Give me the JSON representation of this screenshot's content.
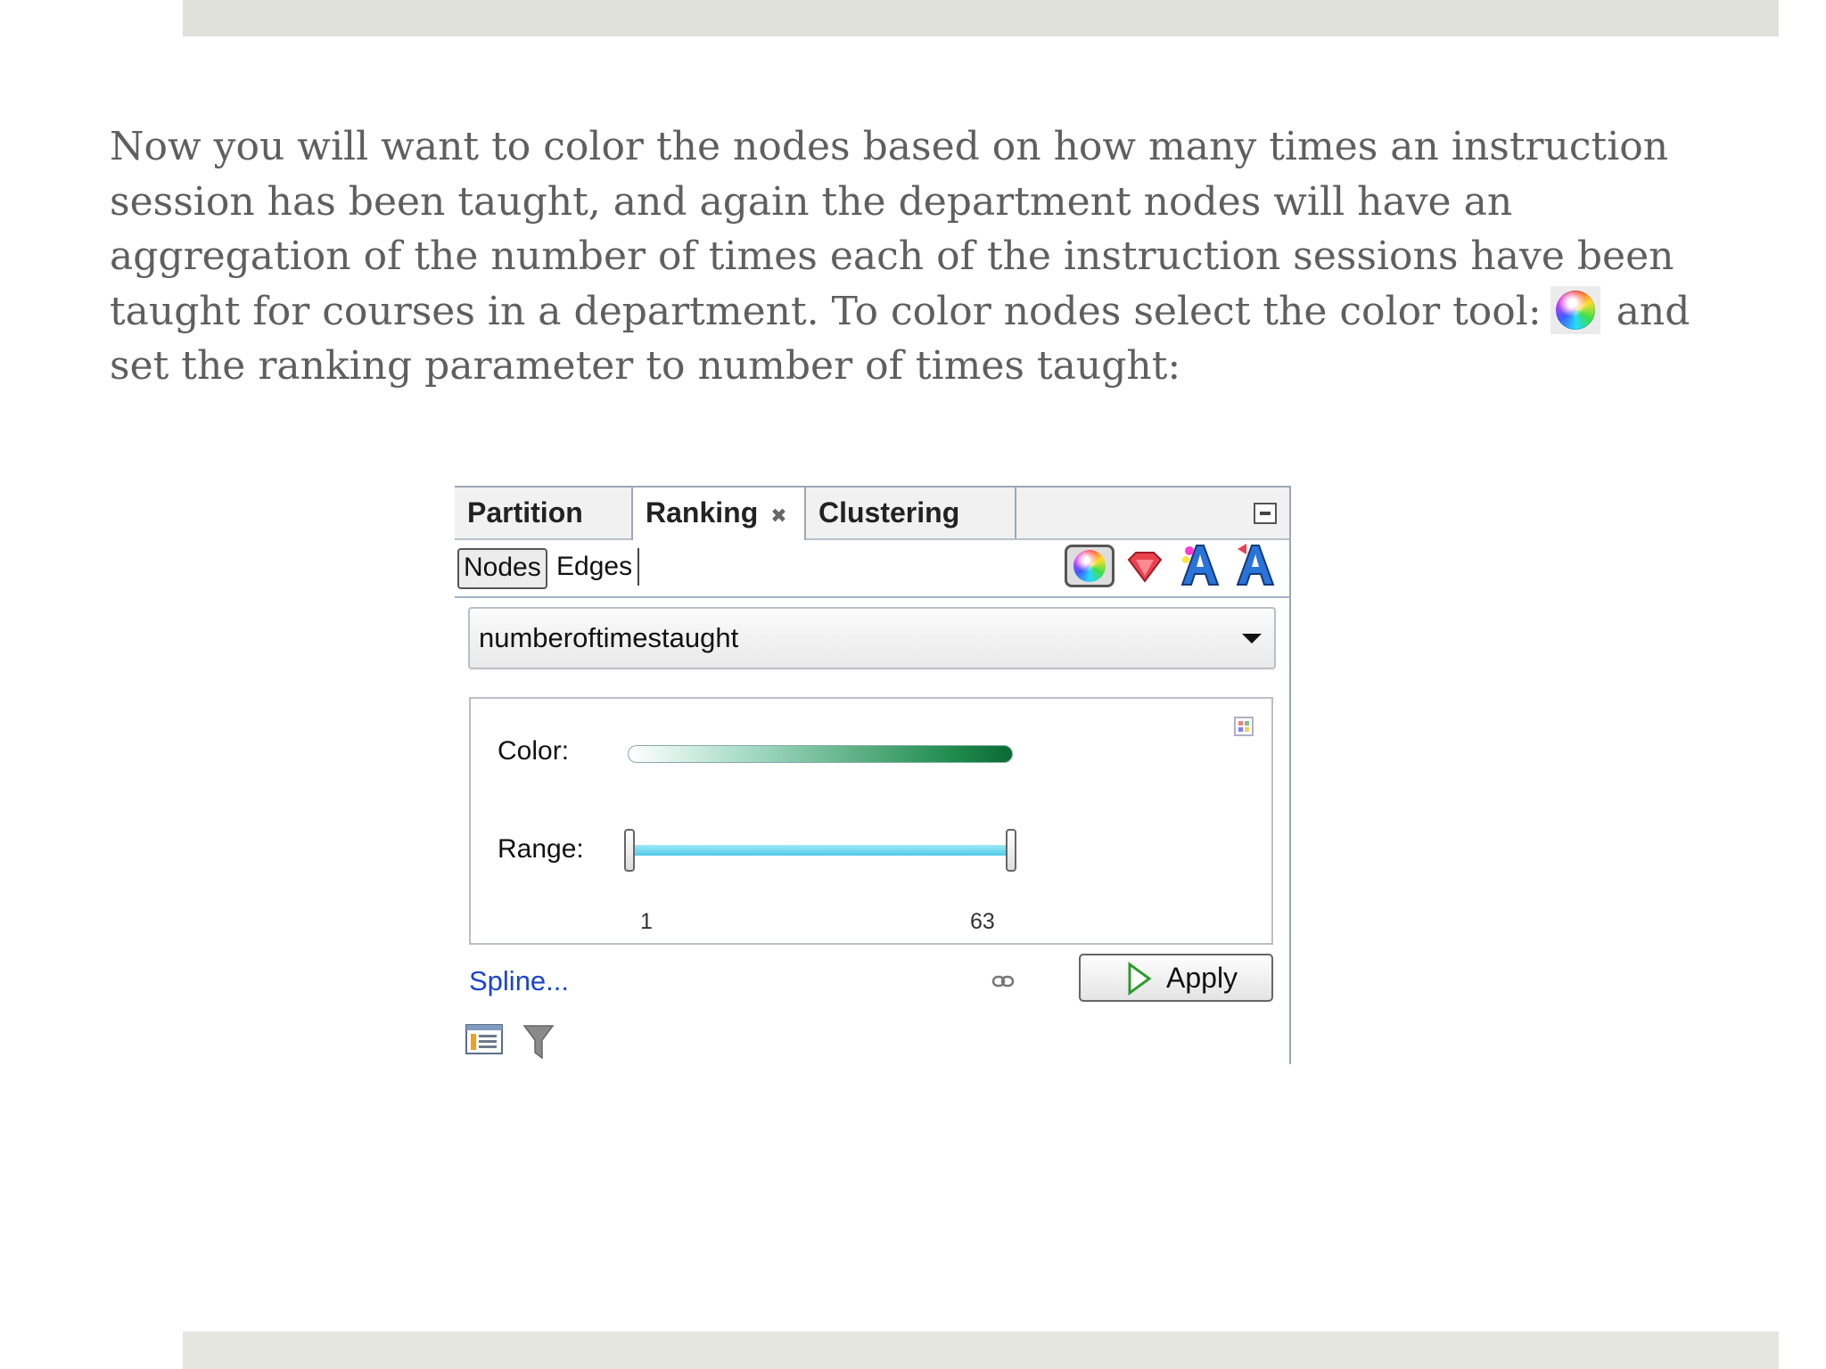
{
  "intro": {
    "line1": "Now you will want to color the nodes based on how many times an instruction",
    "line2": "session has been taught, and again the department nodes will have an",
    "line3": "aggregation of the number of times each of the instruction sessions have been",
    "line4_before": "taught for courses in a department. To color nodes select the color tool:",
    "line4_after": "and",
    "line5": "set the ranking parameter to number of times taught:"
  },
  "tabs": [
    {
      "label": "Partition"
    },
    {
      "label": "Ranking"
    },
    {
      "label": "Clustering"
    }
  ],
  "subbar": {
    "nodes_label": "Nodes",
    "edges_label": "Edges"
  },
  "dropdown": {
    "selected": "numberoftimestaught"
  },
  "settings": {
    "color_label": "Color:",
    "range_label": "Range:",
    "range_min": "1",
    "range_max": "63",
    "gradient_colors": [
      "#ffffff",
      "#1f8b4c",
      "#0b6a33"
    ]
  },
  "footer": {
    "spline_label": "Spline...",
    "apply_label": "Apply"
  },
  "colors": {
    "link": "#1a44cc",
    "range_track": "#4fc9e6"
  }
}
